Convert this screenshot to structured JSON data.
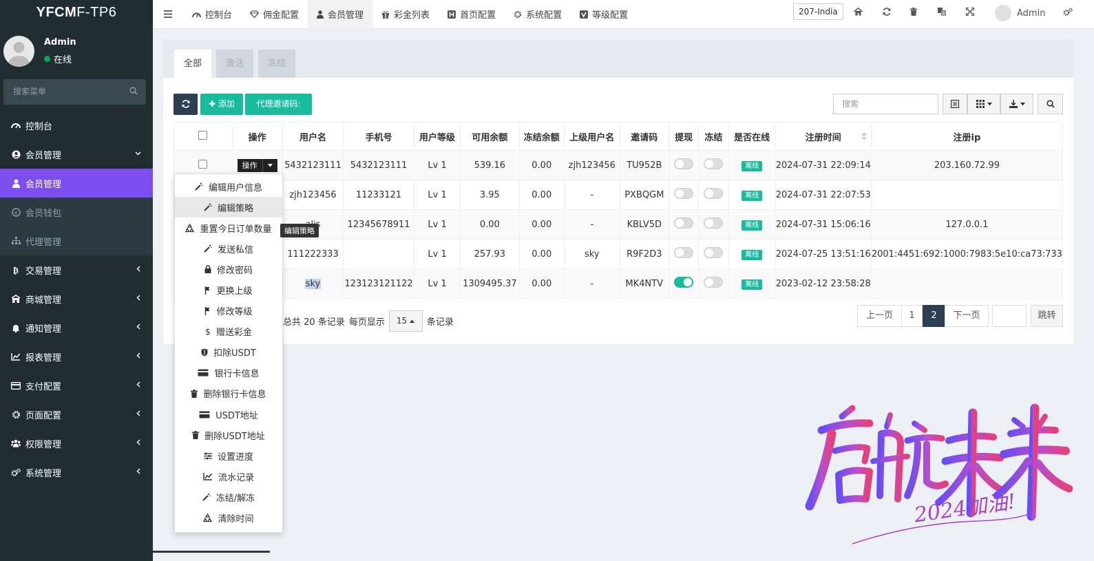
{
  "logo": {
    "bold": "YFCM",
    "thin": "F-TP6"
  },
  "user": {
    "name": "Admin",
    "status": "在线"
  },
  "sidebar": {
    "search_placeholder": "搜索菜单",
    "items": [
      {
        "label": "控制台"
      },
      {
        "label": "会员管理"
      },
      {
        "label": "会员管理"
      },
      {
        "label": "会员钱包"
      },
      {
        "label": "代理管理"
      },
      {
        "label": "交易管理"
      },
      {
        "label": "商城管理"
      },
      {
        "label": "通知管理"
      },
      {
        "label": "报表管理"
      },
      {
        "label": "支付配置"
      },
      {
        "label": "页面配置"
      },
      {
        "label": "权限管理"
      },
      {
        "label": "系统管理"
      }
    ]
  },
  "topnav": {
    "tabs": [
      {
        "label": "控制台"
      },
      {
        "label": "佣金配置"
      },
      {
        "label": "会员管理"
      },
      {
        "label": "彩金列表"
      },
      {
        "label": "首页配置"
      },
      {
        "label": "系统配置"
      },
      {
        "label": "等级配置"
      }
    ],
    "lang": "207-India",
    "admin": "Admin"
  },
  "panel_tabs": [
    {
      "label": "全部"
    },
    {
      "label": "激活"
    },
    {
      "label": "冻结"
    }
  ],
  "toolbar": {
    "add_label": "添加",
    "invite_label": "代理邀请码:",
    "search_placeholder": "搜索"
  },
  "table": {
    "headers": [
      "操作",
      "用户名",
      "手机号",
      "用户等级",
      "可用余额",
      "冻结余额",
      "上级用户名",
      "邀请码",
      "提现",
      "冻结",
      "是否在线",
      "注册时间",
      "注册ip"
    ],
    "op_label": "操作",
    "rows": [
      {
        "username": "5432123111",
        "phone": "5432123111",
        "level": "Lv 1",
        "balance": "539.16",
        "frozen": "0.00",
        "parent": "zjh123456",
        "code": "TU952B",
        "withdraw": false,
        "freeze": false,
        "online": "离线",
        "time": "2024-07-31 22:09:14",
        "ip": "203.160.72.99"
      },
      {
        "username": "zjh123456",
        "phone": "11233121",
        "level": "Lv 1",
        "balance": "3.95",
        "frozen": "0.00",
        "parent": "-",
        "code": "PXBQGM",
        "withdraw": false,
        "freeze": false,
        "online": "离线",
        "time": "2024-07-31 22:07:53",
        "ip": ""
      },
      {
        "username": "alis",
        "phone": "12345678911",
        "level": "Lv 1",
        "balance": "0.00",
        "frozen": "0.00",
        "parent": "-",
        "code": "KBLV5D",
        "withdraw": false,
        "freeze": false,
        "online": "离线",
        "time": "2024-07-31 15:06:16",
        "ip": "127.0.0.1"
      },
      {
        "username": "111222333",
        "phone": "",
        "level": "Lv 1",
        "balance": "257.93",
        "frozen": "0.00",
        "parent": "sky",
        "code": "R9F2D3",
        "withdraw": false,
        "freeze": false,
        "online": "离线",
        "time": "2024-07-25 13:51:16",
        "ip": "2001:4451:692:1000:7983:5e10:ca73:733"
      },
      {
        "username": "sky",
        "phone": "123123121122",
        "level": "Lv 1",
        "balance": "1309495.37",
        "frozen": "0.00",
        "parent": "-",
        "code": "MK4NTV",
        "withdraw": true,
        "freeze": false,
        "online": "离线",
        "time": "2023-02-12 23:58:28",
        "ip": ""
      }
    ]
  },
  "dropdown": {
    "items": [
      {
        "label": "编辑用户信息",
        "icon": "magic-icon"
      },
      {
        "label": "编辑策略",
        "icon": "magic-icon"
      },
      {
        "label": "重置今日订单数量",
        "icon": "recycle-icon"
      },
      {
        "label": "发送私信",
        "icon": "magic-icon"
      },
      {
        "label": "修改密码",
        "icon": "lock-icon"
      },
      {
        "label": "更换上级",
        "icon": "flag-icon"
      },
      {
        "label": "修改等级",
        "icon": "flag-icon"
      },
      {
        "label": "赠送彩金",
        "icon": "dollar-icon"
      },
      {
        "label": "扣除USDT",
        "icon": "shield-icon"
      },
      {
        "label": "银行卡信息",
        "icon": "card-icon"
      },
      {
        "label": "删除银行卡信息",
        "icon": "trash-icon"
      },
      {
        "label": "USDT地址",
        "icon": "card-icon"
      },
      {
        "label": "删除USDT地址",
        "icon": "trash-icon"
      },
      {
        "label": "设置进度",
        "icon": "sliders-icon"
      },
      {
        "label": "流水记录",
        "icon": "chart-icon"
      },
      {
        "label": "冻结/解冻",
        "icon": "magic-icon"
      },
      {
        "label": "清除时间",
        "icon": "recycle-icon"
      }
    ],
    "tooltip": "编辑策略"
  },
  "pager": {
    "total": "总共 20 条记录",
    "per_page_label": "每页显示",
    "per_page": "15",
    "unit": "条记录",
    "prev": "上一页",
    "page1": "1",
    "page2": "2",
    "next": "下一页",
    "jump": "跳转"
  },
  "watermark": {
    "line1": "启航未来",
    "line2": "2024加油!"
  },
  "colors": {
    "accent": "#7c4ef0",
    "sidebar": "#222d32",
    "success": "#18bc9c",
    "dark": "#2c3e50"
  }
}
